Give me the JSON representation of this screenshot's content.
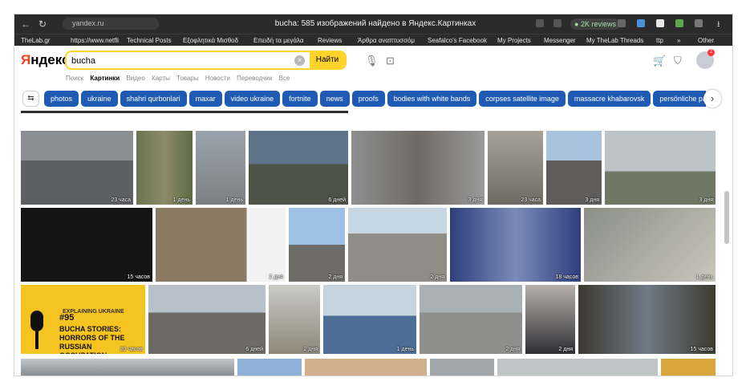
{
  "browser": {
    "url": "yandex.ru",
    "window_title": "bucha: 585 изображений найдено в Яндекс.Картинках",
    "reviews_badge": "2K reviews",
    "bookmarks": [
      "TheLab.gr",
      "https://www.netfli",
      "Technical Posts",
      "Εξοφλητικά Μισθοδ",
      "Επειδή τα μεγάλα",
      "Reviews",
      "Άρθρα αναπτυσσόμ",
      "Seafalco's Facebook",
      "My Projects",
      "Messenger",
      "My TheLab Threads",
      "ttp",
      "»",
      "Other"
    ]
  },
  "yandex": {
    "logo_ya": "Я",
    "logo_rest": "ндекс",
    "query": "bucha",
    "search_button": "Найти",
    "notification_count": "2",
    "tabs": [
      "Поиск",
      "Картинки",
      "Видео",
      "Карты",
      "Товары",
      "Новости",
      "Переводчик",
      "Все"
    ],
    "active_tab": "Картинки"
  },
  "chips": [
    "photos",
    "ukraine",
    "shahri qurbonlari",
    "maxar",
    "video ukraine",
    "fortnite",
    "news",
    "proofs",
    "bodies with white bands",
    "corpses satellite image",
    "massacre khabarovsk",
    "persönliche partne"
  ],
  "grid": {
    "row1": [
      "23 часа",
      "1 день",
      "1 день",
      "6 дней",
      "3 дня",
      "23 часа",
      "3 дня",
      "3 дня"
    ],
    "row2": [
      "15 часов",
      "2 дня",
      "2 дня",
      "2 дня",
      "18 часов",
      "1 день"
    ],
    "row3": [
      "20 часов",
      "6 дней",
      "2 дня",
      "1 день",
      "2 дня",
      "2 дня",
      "15 часов"
    ]
  },
  "poster": {
    "kicker": "EXPLAINING UKRAINE",
    "number": "#95",
    "headline": "BUCHA STORIES: HORRORS OF THE RUSSIAN OCCUPATION"
  },
  "colors": {
    "accent_yellow": "#fed42b",
    "chip_blue": "#1f5bb5",
    "logo_red": "#fc3f1d"
  }
}
